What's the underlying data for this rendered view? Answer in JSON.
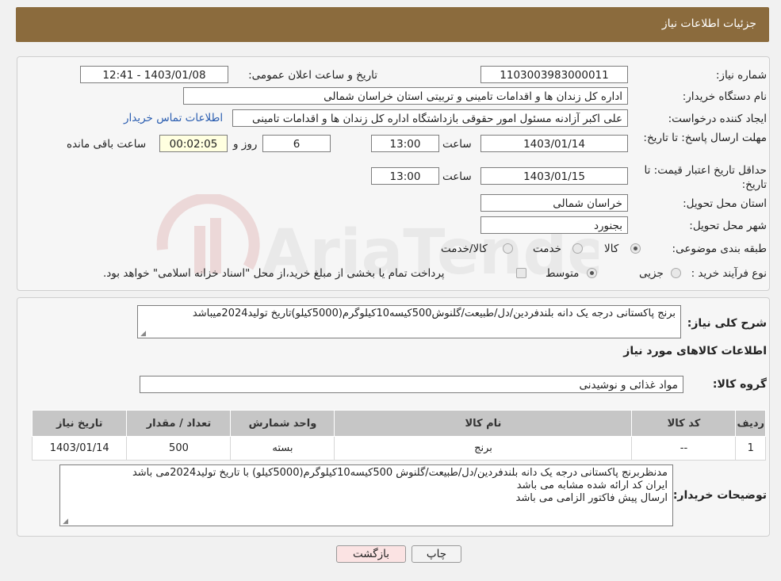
{
  "header": {
    "title": "جزئیات اطلاعات نیاز"
  },
  "form": {
    "need_number_label": "شماره نیاز:",
    "need_number": "1103003983000011",
    "announce_label": "تاریخ و ساعت اعلان عمومی:",
    "announce_value": "1403/01/08 - 12:41",
    "buyer_org_label": "نام دستگاه خریدار:",
    "buyer_org": "اداره کل زندان ها و اقدامات تامینی و تربیتی استان خراسان شمالی",
    "creator_label": "ایجاد کننده درخواست:",
    "creator": "علی اکبر  آزادنه مسئول امور حقوقی بازداشتگاه اداره کل زندان ها و اقدامات تامینی",
    "contact_link": "اطلاعات تماس خریدار",
    "deadline_label": "مهلت ارسال پاسخ: تا تاریخ:",
    "deadline_date": "1403/01/14",
    "time_label": "ساعت",
    "deadline_time": "13:00",
    "days_value": "6",
    "days_label": "روز و",
    "remaining_value": "00:02:05",
    "remaining_label": "ساعت باقی مانده",
    "validity_label": "حداقل تاریخ اعتبار قیمت: تا تاریخ:",
    "validity_date": "1403/01/15",
    "validity_time": "13:00",
    "province_label": "استان محل تحویل:",
    "province": "خراسان شمالی",
    "city_label": "شهر محل تحویل:",
    "city": "بجنورد",
    "category_label": "طبقه بندی موضوعی:",
    "category_options": [
      "کالا",
      "خدمت",
      "کالا/خدمت"
    ],
    "category_selected": "کالا",
    "process_label": "نوع فرآیند خرید :",
    "process_options": [
      "جزیی",
      "متوسط"
    ],
    "process_selected": "متوسط",
    "process_note": "پرداخت تمام یا بخشی از مبلغ خرید،از محل \"اسناد خزانه اسلامی\" خواهد بود."
  },
  "summary": {
    "label": "شرح کلی نیاز:",
    "text": "برنج پاکستانی درجه یک دانه بلندفردین/دل/طبیعت/گلنوش500کیسه10کیلوگرم(5000کیلو)تاریخ تولید2024میباشد"
  },
  "goods": {
    "section_title": "اطلاعات کالاهای مورد نیاز",
    "group_label": "گروه کالا:",
    "group_value": "مواد غذائی و نوشیدنی",
    "columns": [
      "ردیف",
      "کد کالا",
      "نام کالا",
      "واحد شمارش",
      "تعداد / مقدار",
      "تاریخ نیاز"
    ],
    "rows": [
      {
        "row": "1",
        "code": "--",
        "name": "برنج",
        "unit": "بسته",
        "qty": "500",
        "date": "1403/01/14"
      }
    ]
  },
  "buyer_notes": {
    "label": "توضیحات خریدار:",
    "line1": "مدنظربرنج پاکستانی درجه یک دانه بلندفردین/دل/طبیعت/گلنوش 500کیسه10کیلوگرم(5000کیلو) با تاریخ تولید2024می باشد",
    "line2": "ایران کد ارائه شده مشابه می باشد",
    "line3": "ارسال پیش فاکتور الزامی می باشد"
  },
  "buttons": {
    "print": "چاپ",
    "back": "بازگشت"
  },
  "watermark": {
    "brand": "AriaTender.neT"
  },
  "colors": {
    "header": "#8b6b3d",
    "link": "#2a5db0",
    "back_button": "#fbe3e3",
    "remaining_box": "#ffffe0"
  }
}
